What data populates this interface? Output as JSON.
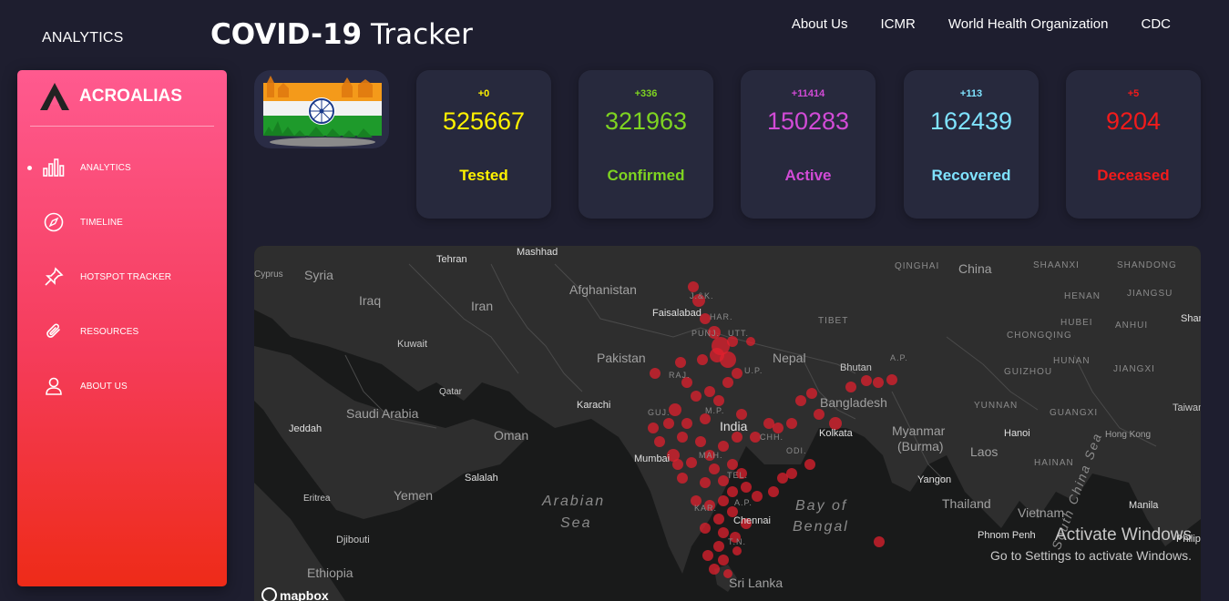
{
  "header": {
    "brand_small": "ANALYTICS",
    "title_part1": "COVID-19",
    "title_part2": " Tracker",
    "nav": [
      "About Us",
      "ICMR",
      "World Health Organization",
      "CDC"
    ]
  },
  "sidebar": {
    "logo": "ACROALIAS",
    "items": [
      {
        "label": "ANALYTICS",
        "icon": "bar-chart-icon",
        "active": true
      },
      {
        "label": "TIMELINE",
        "icon": "compass-icon"
      },
      {
        "label": "HOTSPOT TRACKER",
        "icon": "pin-icon"
      },
      {
        "label": "RESOURCES",
        "icon": "paperclip-icon"
      },
      {
        "label": "ABOUT US",
        "icon": "user-icon"
      }
    ]
  },
  "stats": [
    {
      "delta": "+0",
      "value": "525667",
      "label": "Tested",
      "color": "#fff200"
    },
    {
      "delta": "+336",
      "value": "321963",
      "label": "Confirmed",
      "color": "#7ed321"
    },
    {
      "delta": "+11414",
      "value": "150283",
      "label": "Active",
      "color": "#d24bd6"
    },
    {
      "delta": "+113",
      "value": "162439",
      "label": "Recovered",
      "color": "#7fe3ff"
    },
    {
      "delta": "+5",
      "value": "9204",
      "label": "Deceased",
      "color": "#f21b1b"
    }
  ],
  "map": {
    "labels": {
      "countries": [
        "Syria",
        "Iraq",
        "Iran",
        "Afghanistan",
        "Pakistan",
        "Kuwait",
        "Qatar",
        "Saudi Arabia",
        "Oman",
        "Yemen",
        "Eritrea",
        "Ethiopia",
        "Djibouti",
        "India",
        "Nepal",
        "Bhutan",
        "Bangladesh",
        "Myanmar",
        "(Burma)",
        "Laos",
        "Thailand",
        "Vietnam",
        "China",
        "Sri Lanka",
        "Taiwan"
      ],
      "regions": [
        "QINGHAI",
        "SHAANXI",
        "SHANDONG",
        "HENAN",
        "JIANGSU",
        "HUBEI",
        "ANHUI",
        "TIBET",
        "CHONGQING",
        "HUNAN",
        "JIANGXI",
        "GUIZHOU",
        "YUNNAN",
        "GUANGXI",
        "HAINAN",
        "Hong Kong",
        "Cyprus",
        "J.&K.",
        "PUNJ.",
        "HAR.",
        "UTT.",
        "RAJ.",
        "U.P.",
        "GUJ.",
        "M.P.",
        "CHH.",
        "ODI.",
        "MAH.",
        "TEL.",
        "A.P.",
        "KAR.",
        "T.N.",
        "A.P."
      ],
      "cities": [
        "Tehran",
        "Mashhad",
        "Faisalabad",
        "Karachi",
        "Jeddah",
        "Salalah",
        "Mumbai",
        "Chennai",
        "Kolkata",
        "Yangon",
        "Hanoi",
        "Manila",
        "Phnom Penh",
        "Shan",
        "Philipp"
      ],
      "seas": [
        "Arabian",
        "Sea",
        "Bay of",
        "Bengal",
        "South China Sea"
      ]
    },
    "attribution": "mapbox",
    "watermark_title": "Activate Windows",
    "watermark_sub": "Go to Settings to activate Windows."
  }
}
